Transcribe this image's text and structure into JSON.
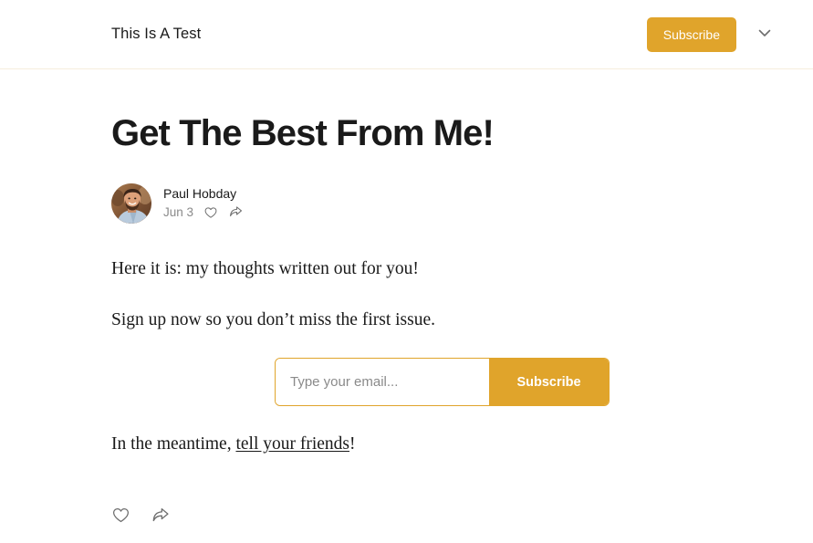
{
  "header": {
    "publication_title": "This Is A Test",
    "subscribe_label": "Subscribe",
    "chevron_icon": "chevron-down-icon",
    "accent_color": "#e0a42b",
    "divider_color": "#f6eedd"
  },
  "post": {
    "title": "Get The Best From Me!",
    "author": {
      "name": "Paul Hobday",
      "avatar_alt": "avatar"
    },
    "date": "Jun 3",
    "meta_icons": {
      "like": "heart-icon",
      "share": "share-icon"
    },
    "paragraph_1": "Here it is: my thoughts written out for you!",
    "paragraph_2": "Sign up now so you don’t miss the first issue.",
    "paragraph_3_prefix": "In the meantime, ",
    "paragraph_3_link": "tell your friends",
    "paragraph_3_suffix": "!",
    "footer_icons": {
      "like": "heart-icon",
      "share": "share-icon"
    }
  },
  "subscribe_form": {
    "email_placeholder": "Type your email...",
    "email_value": "",
    "submit_label": "Subscribe",
    "accent_color": "#e0a42b"
  }
}
